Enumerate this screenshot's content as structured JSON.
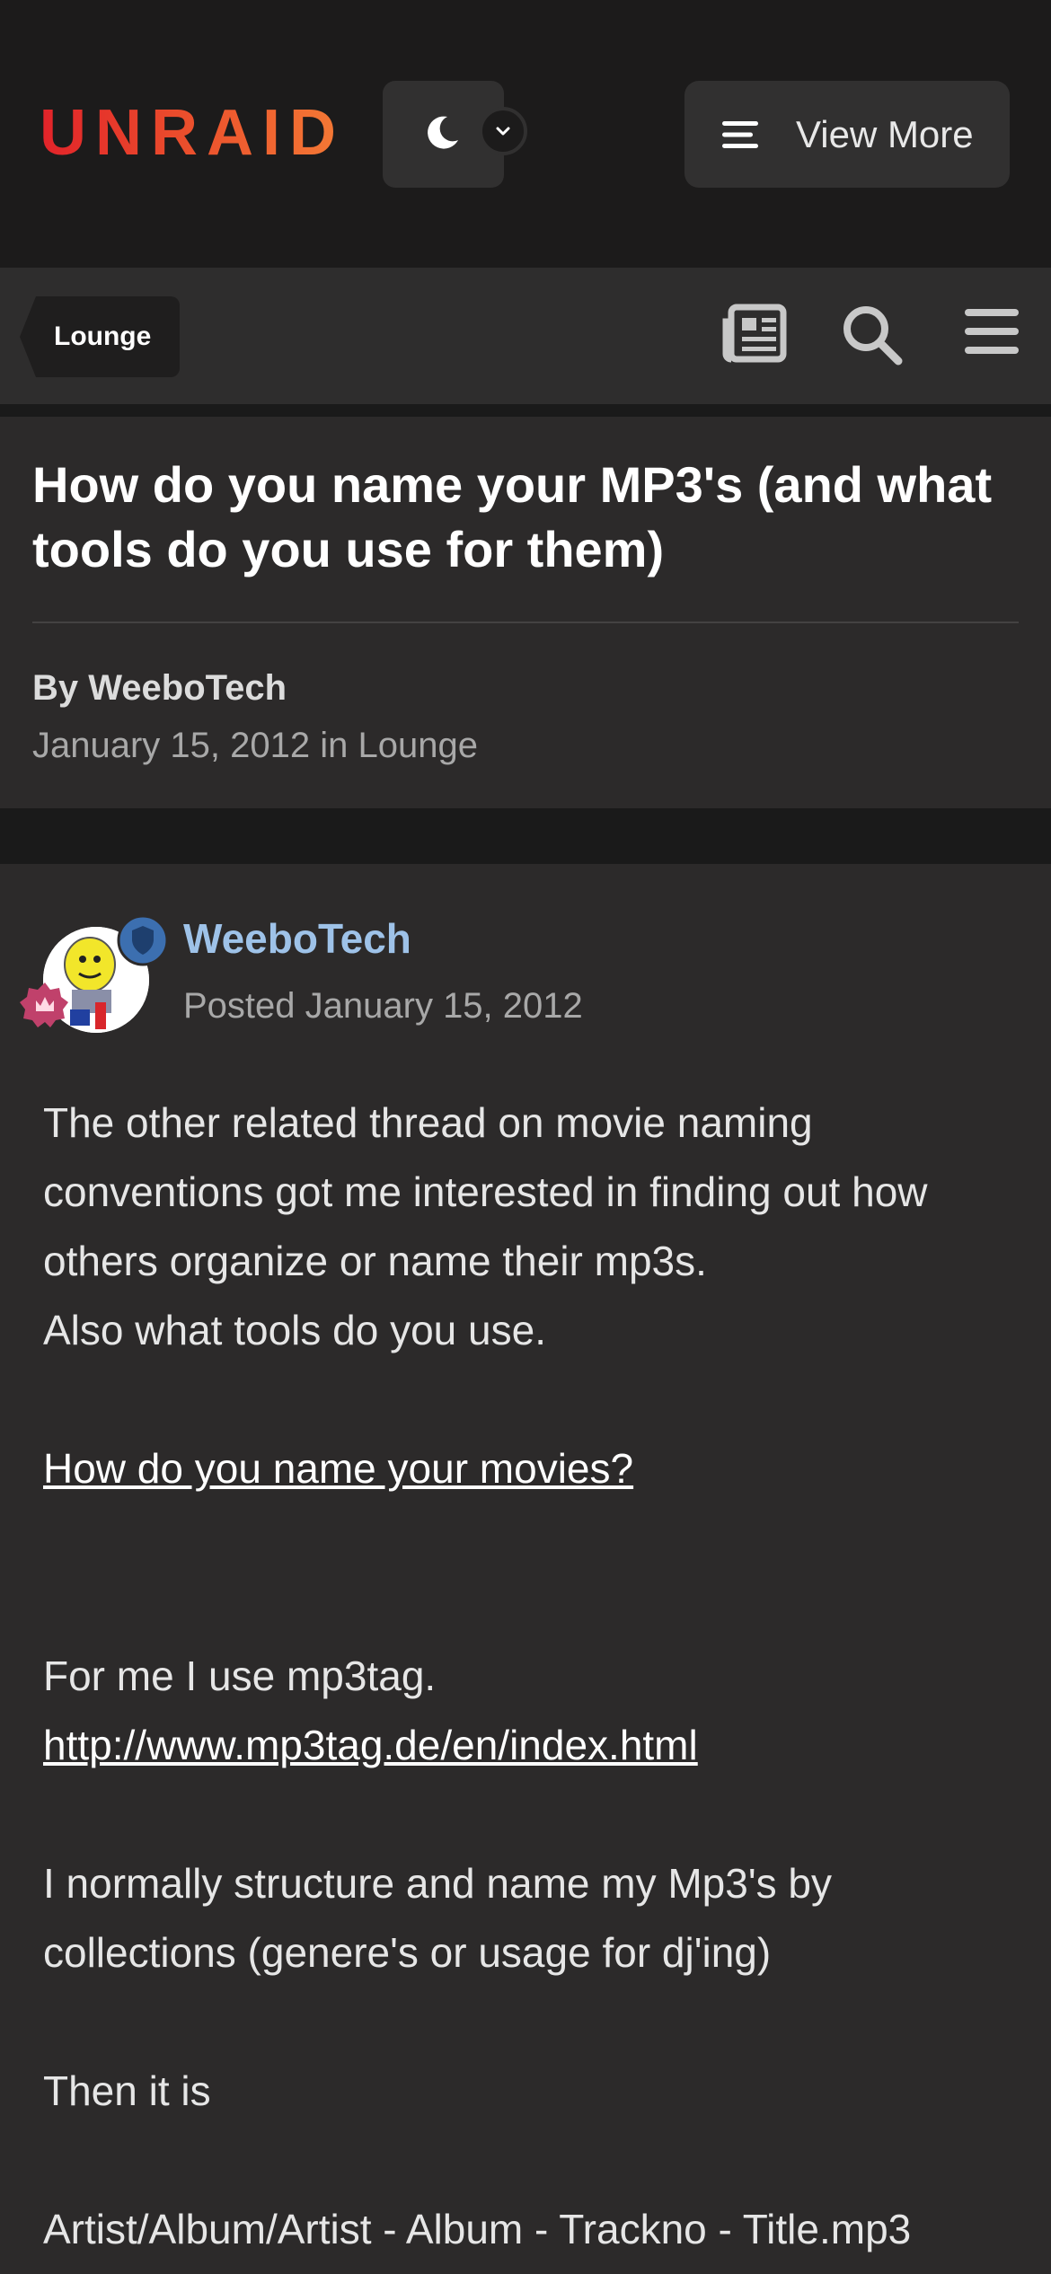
{
  "header": {
    "logo_text": "UNRAID",
    "view_more_label": "View More",
    "theme_toggle_icon": "moon-icon"
  },
  "nav": {
    "breadcrumb_label": "Lounge",
    "icons": [
      "newspaper-icon",
      "search-icon",
      "menu-icon"
    ]
  },
  "topic": {
    "title": "How do you name your MP3's (and what tools do you use for them)",
    "by_line": "By WeeboTech",
    "date_line": "January 15, 2012 in Lounge"
  },
  "post": {
    "author": "WeeboTech",
    "posted": "Posted January 15, 2012",
    "body": {
      "p1": "The other related thread on movie naming conventions got me interested in finding out how others organize or name their mp3s.",
      "p2": "Also what tools do you use.",
      "link1": "How do you name your movies?",
      "p3": "For me I use mp3tag.",
      "link2": "http://www.mp3tag.de/en/index.html",
      "p4": "I normally structure and name my Mp3's by collections (genere's or usage for dj'ing)",
      "p5": "Then it is",
      "p6": "Artist/Album/Artist - Album - Trackno - Title.mp3"
    }
  },
  "colors": {
    "brand_gradient_start": "#e2232a",
    "brand_gradient_end": "#f47a35",
    "author_link": "#9ec2e8",
    "background": "#1a1a1a",
    "panel": "#2c2a2a"
  }
}
